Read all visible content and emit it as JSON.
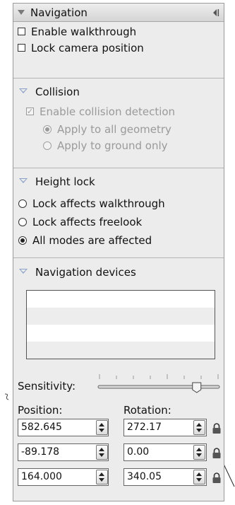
{
  "panel": {
    "title": "Navigation",
    "walkthrough": {
      "enable_label": "Enable walkthrough",
      "lock_camera_label": "Lock camera position"
    },
    "collision": {
      "header": "Collision",
      "enable_label": "Enable collision detection",
      "options": [
        "Apply to all geometry",
        "Apply to ground only"
      ],
      "selected": 0
    },
    "height_lock": {
      "header": "Height lock",
      "options": [
        "Lock affects walkthrough",
        "Lock affects freelook",
        "All modes are affected"
      ],
      "selected": 2
    },
    "devices": {
      "header": "Navigation devices"
    },
    "sensitivity": {
      "label": "Sensitivity:",
      "level": 0.82
    },
    "position": {
      "label": "Position:",
      "values": [
        "582.645",
        "-89.178",
        "164.000"
      ]
    },
    "rotation": {
      "label": "Rotation:",
      "values": [
        "272.17",
        "0.00",
        "340.05"
      ]
    }
  },
  "colors": {
    "panel_bg": "#ececec",
    "disabled_text": "#9a9a9a",
    "section_triangle": "#8aa0c8"
  },
  "icons": [
    "chevron-down-icon",
    "collapse-panel-icon",
    "lock-icon"
  ]
}
